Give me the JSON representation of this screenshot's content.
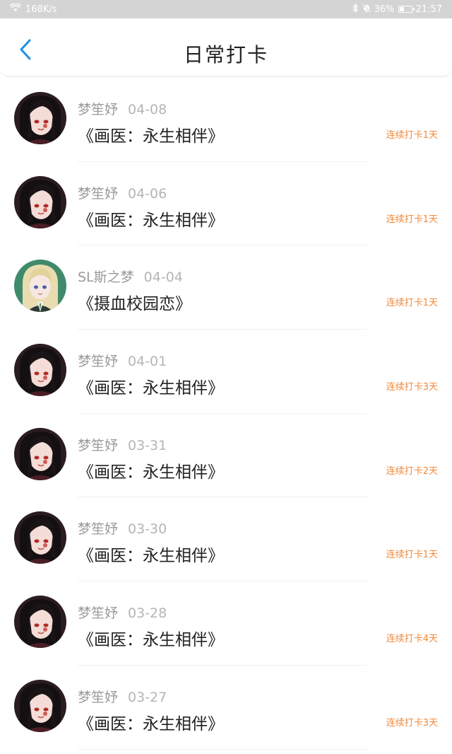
{
  "status_bar": {
    "network_speed": "168K/s",
    "battery": "36%",
    "time": "21:57"
  },
  "header": {
    "title": "日常打卡",
    "back_icon": "chevron-left-icon",
    "accent": "#1e90e6"
  },
  "entries": [
    {
      "user": "梦笙妤",
      "date": "04-08",
      "book": "《画医：永生相伴》",
      "streak": "连续打卡1天",
      "avatar": "dark"
    },
    {
      "user": "梦笙妤",
      "date": "04-06",
      "book": "《画医：永生相伴》",
      "streak": "连续打卡1天",
      "avatar": "dark"
    },
    {
      "user": "SL斯之梦",
      "date": "04-04",
      "book": "《摄血校园恋》",
      "streak": "连续打卡1天",
      "avatar": "green"
    },
    {
      "user": "梦笙妤",
      "date": "04-01",
      "book": "《画医：永生相伴》",
      "streak": "连续打卡3天",
      "avatar": "dark"
    },
    {
      "user": "梦笙妤",
      "date": "03-31",
      "book": "《画医：永生相伴》",
      "streak": "连续打卡2天",
      "avatar": "dark"
    },
    {
      "user": "梦笙妤",
      "date": "03-30",
      "book": "《画医：永生相伴》",
      "streak": "连续打卡1天",
      "avatar": "dark"
    },
    {
      "user": "梦笙妤",
      "date": "03-28",
      "book": "《画医：永生相伴》",
      "streak": "连续打卡4天",
      "avatar": "dark"
    },
    {
      "user": "梦笙妤",
      "date": "03-27",
      "book": "《画医：永生相伴》",
      "streak": "连续打卡3天",
      "avatar": "dark"
    }
  ],
  "colors": {
    "streak": "#f08a3c",
    "meta": "#9a9a9a"
  }
}
